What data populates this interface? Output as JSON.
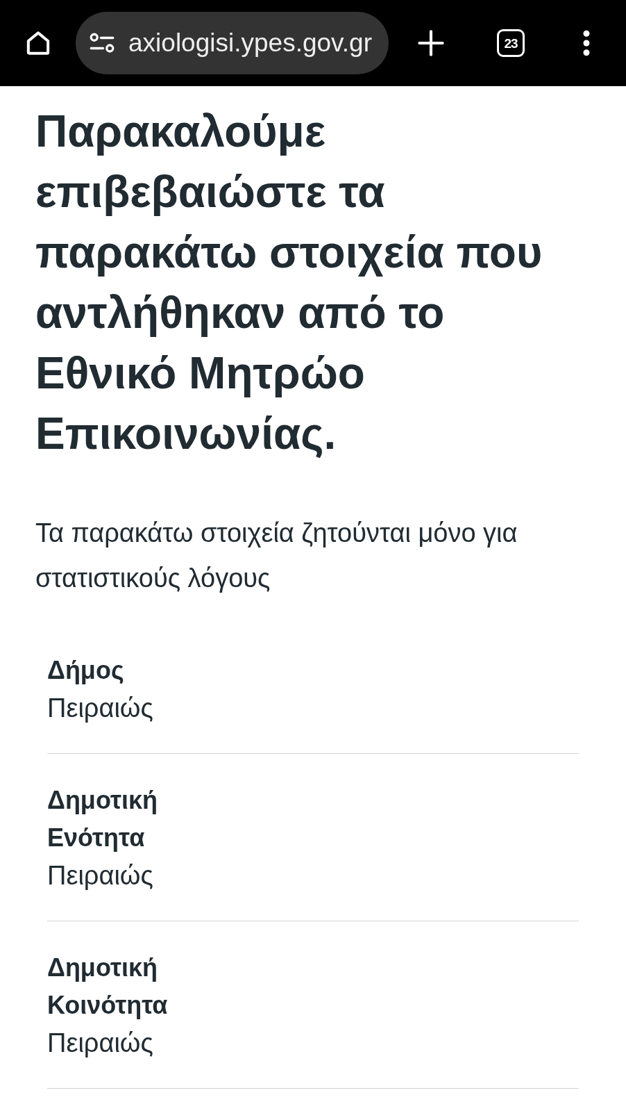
{
  "browser_bar": {
    "url": "axiologisi.ypes.gov.gr",
    "tab_count": "23"
  },
  "heading": "Παρακαλούμε επιβεβαιώστε τα παρακάτω στοιχεία που αντλήθηκαν από το Εθνικό Μητρώο Επικοινωνίας.",
  "intro": "Τα παρακάτω στοιχεία ζητούνται μόνο για στατιστικούς λόγους",
  "fields": [
    {
      "label": "Δήμος",
      "value": "Πειραιώς"
    },
    {
      "label": "Δημοτική Ενότητα",
      "value": "Πειραιώς"
    },
    {
      "label": "Δημοτική Κοινότητα",
      "value": "Πειραιώς"
    }
  ]
}
